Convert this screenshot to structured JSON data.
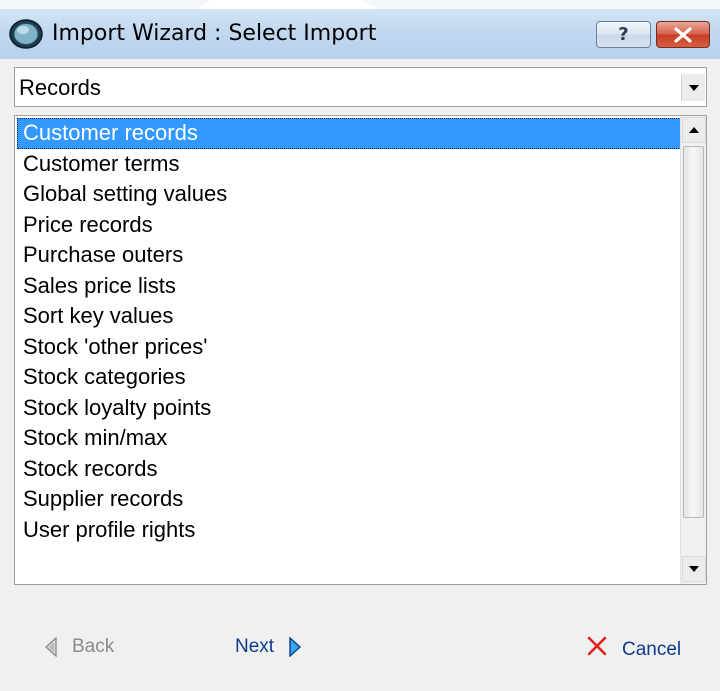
{
  "window": {
    "title": "Import Wizard : Select Import",
    "help_label": "?"
  },
  "dropdown": {
    "value": "Records"
  },
  "list": {
    "selected_index": 0,
    "items": [
      "Customer records",
      "Customer terms",
      "Global setting values",
      "Price records",
      "Purchase outers",
      "Sales price lists",
      "Sort key values",
      "Stock 'other prices'",
      "Stock categories",
      "Stock loyalty points",
      "Stock min/max",
      "Stock records",
      "Supplier records",
      "User profile rights"
    ]
  },
  "footer": {
    "back_label": "Back",
    "next_label": "Next",
    "cancel_label": "Cancel"
  },
  "icons": {
    "app": "globe-icon",
    "help": "help-icon",
    "close": "close-icon",
    "back": "arrow-left-icon",
    "next": "arrow-right-icon",
    "cancel": "cancel-x-icon"
  },
  "colors": {
    "selection": "#3399ff",
    "link_text": "#0e3b8c",
    "disabled_text": "#8a8a8a",
    "close_button": "#c94a33",
    "cancel_x": "#e0201a"
  }
}
